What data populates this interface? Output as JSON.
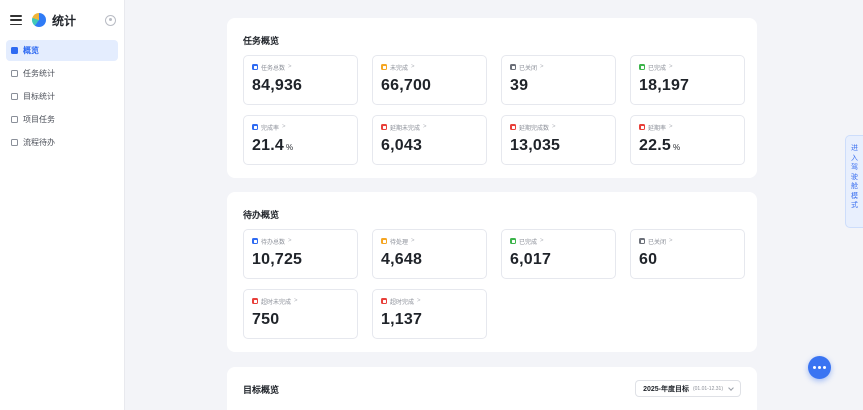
{
  "sidebar": {
    "title": "统计",
    "items": [
      {
        "label": "概览",
        "active": true
      },
      {
        "label": "任务统计",
        "active": false
      },
      {
        "label": "目标统计",
        "active": false
      },
      {
        "label": "项目任务",
        "active": false
      },
      {
        "label": "流程待办",
        "active": false
      }
    ]
  },
  "panels": {
    "task": {
      "title": "任务概览",
      "cards": [
        {
          "label": "任务总数",
          "value": "84,936",
          "unit": "",
          "color": "#2f6bf2"
        },
        {
          "label": "未完成",
          "value": "66,700",
          "unit": "",
          "color": "#f5a623"
        },
        {
          "label": "已关闭",
          "value": "39",
          "unit": "",
          "color": "#6b6f78"
        },
        {
          "label": "已完成",
          "value": "18,197",
          "unit": "",
          "color": "#3cb44b"
        },
        {
          "label": "完成率",
          "value": "21.4",
          "unit": "%",
          "color": "#2f6bf2"
        },
        {
          "label": "延期未完成",
          "value": "6,043",
          "unit": "",
          "color": "#e8403a"
        },
        {
          "label": "延期完成数",
          "value": "13,035",
          "unit": "",
          "color": "#e8403a"
        },
        {
          "label": "延期率",
          "value": "22.5",
          "unit": "%",
          "color": "#e8403a"
        }
      ]
    },
    "todo": {
      "title": "待办概览",
      "cards": [
        {
          "label": "待办总数",
          "value": "10,725",
          "unit": "",
          "color": "#2f6bf2"
        },
        {
          "label": "待处理",
          "value": "4,648",
          "unit": "",
          "color": "#f5a623"
        },
        {
          "label": "已完成",
          "value": "6,017",
          "unit": "",
          "color": "#3cb44b"
        },
        {
          "label": "已关闭",
          "value": "60",
          "unit": "",
          "color": "#6b6f78"
        },
        {
          "label": "超时未完成",
          "value": "750",
          "unit": "",
          "color": "#e8403a"
        },
        {
          "label": "超时完成",
          "value": "1,137",
          "unit": "",
          "color": "#e8403a"
        }
      ]
    },
    "goal": {
      "title": "目标概览",
      "dropdown_label": "2025-年度目标",
      "dropdown_range": "(01.01-12.31)"
    }
  },
  "side_tab": "进入驾驶舱模式",
  "icons": {
    "menu": "menu-icon",
    "logo": "app-logo-icon",
    "settings": "gear-icon",
    "fab": "more-dots-icon"
  }
}
